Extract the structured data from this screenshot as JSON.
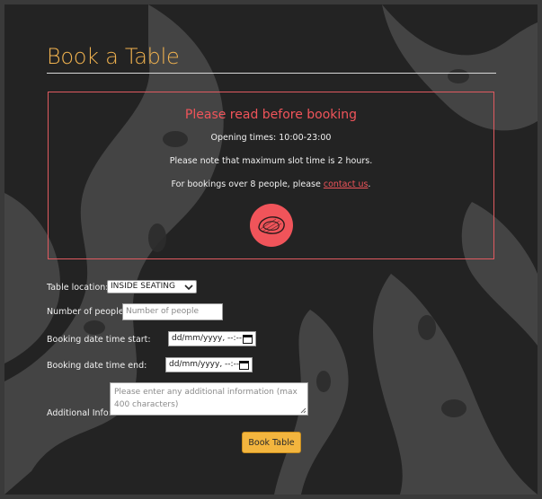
{
  "page": {
    "title": "Book a Table"
  },
  "notice": {
    "heading": "Please read before booking",
    "opening_times": "Opening times: 10:00-23:00",
    "slot_note": "Please note that maximum slot time is 2 hours.",
    "bookings_prefix": "For bookings over 8 people, please ",
    "contact_link": "contact us",
    "bookings_suffix": ".",
    "icon": "steak-icon"
  },
  "form": {
    "table_location": {
      "label": "Table location:",
      "value": "INSIDE SEATING"
    },
    "people": {
      "label": "Number of people:",
      "placeholder": "Number of people"
    },
    "start": {
      "label": "Booking date time start:",
      "value": "dd/mm/yyyy, --:--"
    },
    "end": {
      "label": "Booking date time end:",
      "value": "dd/mm/yyyy, --:--"
    },
    "additional": {
      "label": "Additional Info:",
      "placeholder": "Please enter any additional information (max 400 characters)"
    },
    "submit_label": "Book Table"
  },
  "colors": {
    "accent": "#f0b24f",
    "alert": "#f0545a",
    "background": "#232323",
    "button": "#f3b53e"
  }
}
